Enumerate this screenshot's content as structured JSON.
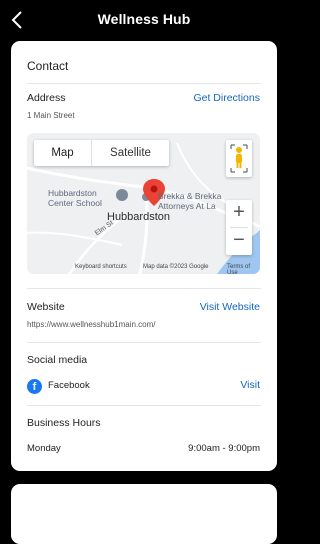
{
  "header": {
    "title": "Wellness Hub"
  },
  "contact": {
    "heading": "Contact",
    "address_label": "Address",
    "address_value": "1 Main Street",
    "directions_link": "Get Directions"
  },
  "map": {
    "type_map": "Map",
    "type_satellite": "Satellite",
    "place_school": "Hubbardston\nCenter School",
    "place_attorneys": "Brekka & Brekka\nAttorneys At La",
    "town": "Hubbardston",
    "street": "Elm St",
    "logo": "Google",
    "keyboard": "Keyboard shortcuts",
    "mapdata": "Map data ©2023 Google",
    "terms": "Terms of Use",
    "zoom_in": "+",
    "zoom_out": "−",
    "colors": {
      "pin": "#ea4335",
      "water": "#9ec6f0",
      "road": "#ffffff"
    }
  },
  "website": {
    "label": "Website",
    "link": "Visit Website",
    "url": "https://www.wellnesshub1main.com/"
  },
  "social": {
    "label": "Social media",
    "facebook_label": "Facebook",
    "visit_link": "Visit",
    "icon": "facebook-icon"
  },
  "hours": {
    "label": "Business Hours",
    "day": "Monday",
    "time": "9:00am - 9:00pm"
  },
  "colors": {
    "link": "#1565c0",
    "header_bg": "#000000",
    "card_bg": "#ffffff"
  }
}
